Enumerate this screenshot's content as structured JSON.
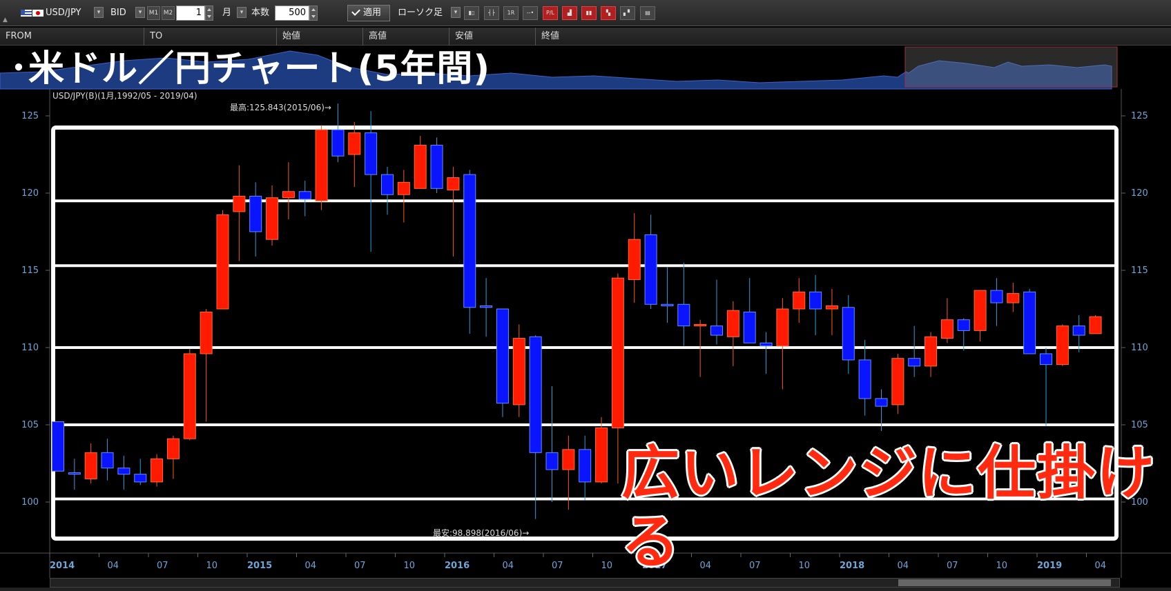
{
  "toolbar": {
    "symbol": "USD/JPY",
    "price_type": "BID",
    "m1_label": "M1",
    "m2_label": "M2",
    "period_value": "1",
    "period_unit": "月",
    "count_label": "本数",
    "count_value": "500",
    "apply_label": "適用",
    "chart_type": "ローソク足",
    "tools": [
      "tool-1",
      "tool-2",
      "tool-3",
      "tool-4",
      "tool-5",
      "tool-6",
      "tool-7",
      "tool-8",
      "tool-9",
      "tool-10"
    ]
  },
  "header": {
    "from_label": "FROM",
    "to_label": "TO",
    "open_label": "始値",
    "high_label": "高値",
    "low_label": "安値",
    "close_label": "終値"
  },
  "overlay": {
    "title": "･米ドル／円チャート(5年間)",
    "caption": "広いレンジに仕掛ける"
  },
  "colors": {
    "up": "#ff1a00",
    "down": "#0a14ff",
    "axis_text": "#6fa6d8",
    "band": "#ffffff"
  },
  "chart_data": {
    "type": "candlestick",
    "subtitle": "USD/JPY(B)(1月,1992/05 - 2019/04)",
    "high_annotation": "最高:125.843(2015/06)→",
    "low_annotation": "最安:98.898(2016/06)→",
    "y_ticks": [
      100,
      105,
      110,
      115,
      120,
      125
    ],
    "ylim": [
      98.0,
      127.0
    ],
    "x_ticks": [
      "2014",
      "04",
      "07",
      "10",
      "2015",
      "04",
      "07",
      "10",
      "2016",
      "04",
      "07",
      "10",
      "2017",
      "04",
      "07",
      "10",
      "2018",
      "04",
      "07",
      "10",
      "2019",
      "04"
    ],
    "year_ticks": [
      "2014",
      "2015",
      "2016",
      "2017",
      "2018",
      "2019"
    ],
    "range_lines": [
      100.2,
      105.0,
      110.0,
      115.3,
      119.5
    ],
    "candles": [
      {
        "date": "2014/01",
        "open": 105.2,
        "high": 105.2,
        "low": 102.0,
        "close": 102.0
      },
      {
        "date": "2014/02",
        "open": 101.9,
        "high": 102.8,
        "low": 100.8,
        "close": 101.8
      },
      {
        "date": "2014/03",
        "open": 101.5,
        "high": 103.8,
        "low": 101.2,
        "close": 103.2
      },
      {
        "date": "2014/04",
        "open": 103.2,
        "high": 104.1,
        "low": 101.4,
        "close": 102.2
      },
      {
        "date": "2014/05",
        "open": 102.2,
        "high": 103.0,
        "low": 100.8,
        "close": 101.8
      },
      {
        "date": "2014/06",
        "open": 101.8,
        "high": 102.8,
        "low": 101.1,
        "close": 101.3
      },
      {
        "date": "2014/07",
        "open": 101.3,
        "high": 103.1,
        "low": 101.0,
        "close": 102.8
      },
      {
        "date": "2014/08",
        "open": 102.8,
        "high": 104.3,
        "low": 101.5,
        "close": 104.1
      },
      {
        "date": "2014/09",
        "open": 104.1,
        "high": 109.9,
        "low": 104.0,
        "close": 109.6
      },
      {
        "date": "2014/10",
        "open": 109.6,
        "high": 112.5,
        "low": 105.2,
        "close": 112.3
      },
      {
        "date": "2014/11",
        "open": 112.5,
        "high": 118.9,
        "low": 112.5,
        "close": 118.6
      },
      {
        "date": "2014/12",
        "open": 118.8,
        "high": 121.8,
        "low": 115.6,
        "close": 119.8
      },
      {
        "date": "2015/01",
        "open": 119.8,
        "high": 120.7,
        "low": 115.9,
        "close": 117.5
      },
      {
        "date": "2015/02",
        "open": 117.0,
        "high": 120.5,
        "low": 116.6,
        "close": 119.7
      },
      {
        "date": "2015/03",
        "open": 119.7,
        "high": 122.0,
        "low": 118.3,
        "close": 120.1
      },
      {
        "date": "2015/04",
        "open": 120.1,
        "high": 120.8,
        "low": 118.5,
        "close": 119.6
      },
      {
        "date": "2015/05",
        "open": 119.5,
        "high": 124.4,
        "low": 118.9,
        "close": 124.1
      },
      {
        "date": "2015/06",
        "open": 124.1,
        "high": 125.8,
        "low": 122.0,
        "close": 122.4
      },
      {
        "date": "2015/07",
        "open": 122.5,
        "high": 124.6,
        "low": 120.4,
        "close": 123.9
      },
      {
        "date": "2015/08",
        "open": 123.9,
        "high": 125.3,
        "low": 116.2,
        "close": 121.2
      },
      {
        "date": "2015/09",
        "open": 121.2,
        "high": 121.7,
        "low": 118.6,
        "close": 119.9
      },
      {
        "date": "2015/10",
        "open": 119.9,
        "high": 121.5,
        "low": 118.1,
        "close": 120.7
      },
      {
        "date": "2015/11",
        "open": 120.3,
        "high": 123.7,
        "low": 120.3,
        "close": 123.1
      },
      {
        "date": "2015/12",
        "open": 123.1,
        "high": 123.6,
        "low": 120.0,
        "close": 120.3
      },
      {
        "date": "2016/01",
        "open": 120.2,
        "high": 121.7,
        "low": 115.9,
        "close": 121.0
      },
      {
        "date": "2016/02",
        "open": 121.2,
        "high": 121.5,
        "low": 110.9,
        "close": 112.6
      },
      {
        "date": "2016/03",
        "open": 112.7,
        "high": 114.5,
        "low": 110.7,
        "close": 112.6
      },
      {
        "date": "2016/04",
        "open": 112.5,
        "high": 112.5,
        "low": 105.5,
        "close": 106.4
      },
      {
        "date": "2016/05",
        "open": 106.3,
        "high": 111.5,
        "low": 105.5,
        "close": 110.6
      },
      {
        "date": "2016/06",
        "open": 110.7,
        "high": 110.8,
        "low": 98.9,
        "close": 103.2
      },
      {
        "date": "2016/07",
        "open": 103.2,
        "high": 107.5,
        "low": 100.0,
        "close": 102.1
      },
      {
        "date": "2016/08",
        "open": 102.1,
        "high": 104.3,
        "low": 99.5,
        "close": 103.4
      },
      {
        "date": "2016/09",
        "open": 103.4,
        "high": 104.3,
        "low": 100.1,
        "close": 101.3
      },
      {
        "date": "2016/10",
        "open": 101.3,
        "high": 105.5,
        "low": 101.2,
        "close": 104.8
      },
      {
        "date": "2016/11",
        "open": 104.8,
        "high": 114.8,
        "low": 101.2,
        "close": 114.5
      },
      {
        "date": "2016/12",
        "open": 114.4,
        "high": 118.7,
        "low": 112.9,
        "close": 117.0
      },
      {
        "date": "2017/01",
        "open": 117.3,
        "high": 118.6,
        "low": 112.5,
        "close": 112.8
      },
      {
        "date": "2017/02",
        "open": 112.8,
        "high": 115.2,
        "low": 111.6,
        "close": 112.7
      },
      {
        "date": "2017/03",
        "open": 112.8,
        "high": 115.5,
        "low": 110.1,
        "close": 111.4
      },
      {
        "date": "2017/04",
        "open": 111.4,
        "high": 111.8,
        "low": 108.1,
        "close": 111.5
      },
      {
        "date": "2017/05",
        "open": 111.4,
        "high": 114.4,
        "low": 110.2,
        "close": 110.8
      },
      {
        "date": "2017/06",
        "open": 110.7,
        "high": 113.0,
        "low": 108.8,
        "close": 112.4
      },
      {
        "date": "2017/07",
        "open": 112.3,
        "high": 114.5,
        "low": 110.6,
        "close": 110.3
      },
      {
        "date": "2017/08",
        "open": 110.3,
        "high": 111.0,
        "low": 108.3,
        "close": 110.1
      },
      {
        "date": "2017/09",
        "open": 110.1,
        "high": 113.2,
        "low": 107.3,
        "close": 112.5
      },
      {
        "date": "2017/10",
        "open": 112.5,
        "high": 114.5,
        "low": 111.6,
        "close": 113.6
      },
      {
        "date": "2017/11",
        "open": 113.6,
        "high": 114.7,
        "low": 110.8,
        "close": 112.5
      },
      {
        "date": "2017/12",
        "open": 112.5,
        "high": 113.8,
        "low": 110.8,
        "close": 112.7
      },
      {
        "date": "2018/01",
        "open": 112.6,
        "high": 113.4,
        "low": 108.3,
        "close": 109.2
      },
      {
        "date": "2018/02",
        "open": 109.2,
        "high": 110.5,
        "low": 105.6,
        "close": 106.7
      },
      {
        "date": "2018/03",
        "open": 106.7,
        "high": 107.3,
        "low": 104.6,
        "close": 106.2
      },
      {
        "date": "2018/04",
        "open": 106.3,
        "high": 109.6,
        "low": 105.7,
        "close": 109.3
      },
      {
        "date": "2018/05",
        "open": 109.3,
        "high": 111.4,
        "low": 108.1,
        "close": 108.8
      },
      {
        "date": "2018/06",
        "open": 108.8,
        "high": 111.0,
        "low": 108.1,
        "close": 110.7
      },
      {
        "date": "2018/07",
        "open": 110.6,
        "high": 113.2,
        "low": 110.3,
        "close": 111.8
      },
      {
        "date": "2018/08",
        "open": 111.8,
        "high": 111.9,
        "low": 109.8,
        "close": 111.1
      },
      {
        "date": "2018/09",
        "open": 111.1,
        "high": 113.7,
        "low": 110.4,
        "close": 113.7
      },
      {
        "date": "2018/10",
        "open": 113.7,
        "high": 114.5,
        "low": 111.4,
        "close": 112.9
      },
      {
        "date": "2018/11",
        "open": 112.9,
        "high": 114.2,
        "low": 112.3,
        "close": 113.5
      },
      {
        "date": "2018/12",
        "open": 113.6,
        "high": 113.8,
        "low": 109.6,
        "close": 109.6
      },
      {
        "date": "2019/01",
        "open": 109.6,
        "high": 110.0,
        "low": 104.9,
        "close": 108.9
      },
      {
        "date": "2019/02",
        "open": 108.9,
        "high": 111.5,
        "low": 108.8,
        "close": 111.4
      },
      {
        "date": "2019/03",
        "open": 111.4,
        "high": 112.1,
        "low": 109.7,
        "close": 110.8
      },
      {
        "date": "2019/04",
        "open": 110.9,
        "high": 112.1,
        "low": 110.9,
        "close": 112.0
      }
    ]
  }
}
